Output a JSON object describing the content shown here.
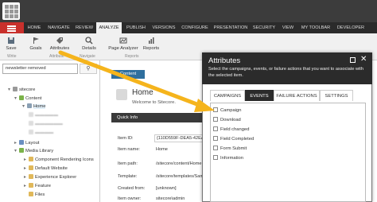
{
  "ribbon": {
    "tabs": [
      "HOME",
      "NAVIGATE",
      "REVIEW",
      "ANALYZE",
      "PUBLISH",
      "VERSIONS",
      "CONFIGURE",
      "PRESENTATION",
      "SECURITY",
      "VIEW",
      "MY TOOLBAR",
      "DEVELOPER"
    ],
    "active_tab": "ANALYZE",
    "buttons": {
      "save": "Save",
      "goals": "Goals",
      "attributes": "Attributes",
      "details": "Details",
      "page_analyzer": "Page Analyzer",
      "reports": "Reports"
    },
    "groups": {
      "write": "Write",
      "attribute": "Attribute",
      "navigate": "Navigate",
      "reports": "Reports"
    }
  },
  "search": {
    "value": "newsletter removed"
  },
  "tree": {
    "sitecore": "sitecore",
    "content": "Content",
    "home": "Home",
    "layout": "Layout",
    "media_library": "Media Library",
    "component_icons": "Component Rendering Icons",
    "default_website": "Default Website",
    "experience_explorer": "Experience Explorer",
    "feature": "Feature",
    "files": "Files"
  },
  "content": {
    "tab": "Content",
    "item_title": "Home",
    "item_subtitle": "Welcome to Sitecore.",
    "quick_info": "Quick Info",
    "fields": [
      {
        "label": "Item ID:",
        "value": "{110D559F-DEA5-42EA-9"
      },
      {
        "label": "Item name:",
        "value": "Home"
      },
      {
        "label": "Item path:",
        "value": "/sitecore/content/Home"
      },
      {
        "label": "Template:",
        "value": "/sitecore/templates/Sam"
      },
      {
        "label": "Created from:",
        "value": "[unknown]"
      },
      {
        "label": "Item owner:",
        "value": "sitecore\\admin"
      }
    ]
  },
  "dialog": {
    "title": "Attributes",
    "description": "Select the campaigns, events, or failure actions that you want to associate with the selected item.",
    "tabs": [
      "CAMPAIGNS",
      "EVENTS",
      "FAILURE ACTIONS",
      "SETTINGS"
    ],
    "active_tab": "EVENTS",
    "options": [
      "Campaign",
      "Download",
      "Field changed",
      "Field Completed",
      "Form Submit",
      "Information"
    ]
  },
  "colors": {
    "accent_red": "#c8302c",
    "ribbon_dark": "#2b2b2b",
    "arrow": "#f5b41c",
    "content_tab": "#2f6f9e"
  }
}
